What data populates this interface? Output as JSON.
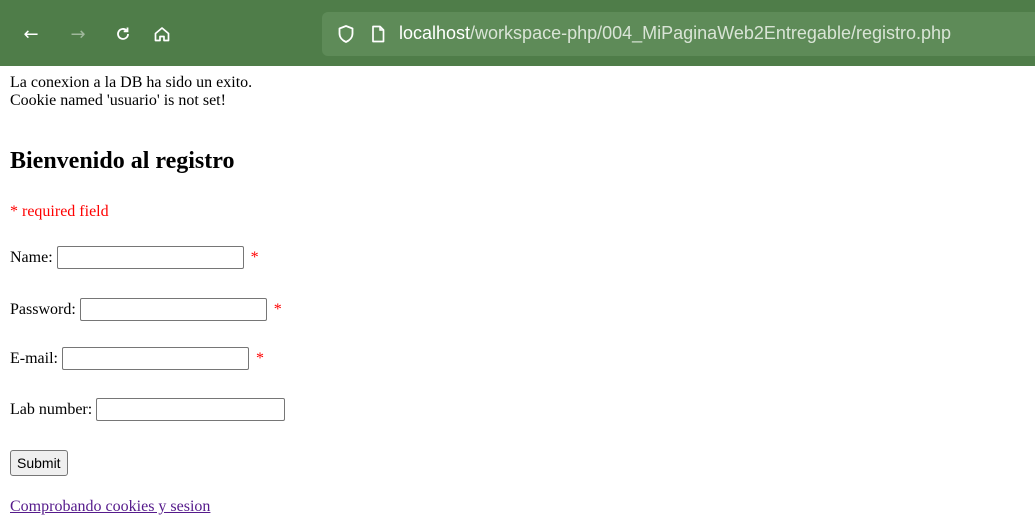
{
  "browser": {
    "url_host": "localhost",
    "url_path": "/workspace-php/004_MiPaginaWeb2Entregable/registro.php",
    "icons": [
      "back-icon",
      "forward-icon",
      "reload-icon",
      "home-icon",
      "shield-icon",
      "page-icon"
    ]
  },
  "page": {
    "messages": [
      "La conexion a la DB ha sido un exito.",
      "Cookie named 'usuario' is not set!"
    ],
    "heading": "Bienvenido al registro",
    "required_note": "* required field",
    "form": {
      "name_label": "Name:",
      "name_value": "",
      "password_label": "Password:",
      "password_value": "",
      "email_label": "E-mail:",
      "email_value": "",
      "lab_label": "Lab number:",
      "lab_value": "",
      "required_mark": "*",
      "submit_label": "Submit"
    },
    "link_text": "Comprobando cookies y sesion"
  },
  "colors": {
    "toolbar": "#4f7d49",
    "urlbar": "#5e8b58",
    "required": "#ff0000",
    "visited_link": "#551a8b"
  }
}
